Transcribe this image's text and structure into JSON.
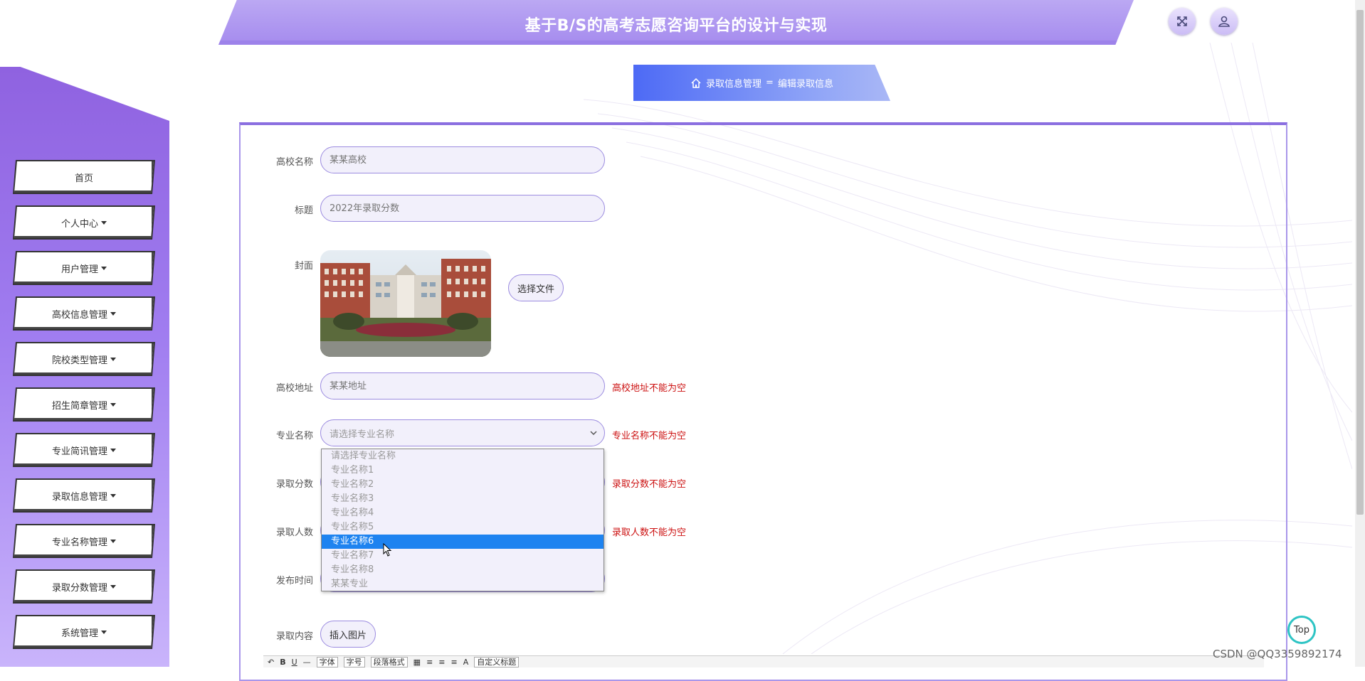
{
  "header": {
    "title": "基于B/S的高考志愿咨询平台的设计与实现",
    "fullscreen_icon": "fullscreen-icon",
    "user_icon": "user-icon"
  },
  "sidebar": {
    "items": [
      {
        "label": "首页",
        "has_caret": false
      },
      {
        "label": "个人中心",
        "has_caret": true
      },
      {
        "label": "用户管理",
        "has_caret": true
      },
      {
        "label": "高校信息管理",
        "has_caret": true
      },
      {
        "label": "院校类型管理",
        "has_caret": true
      },
      {
        "label": "招生简章管理",
        "has_caret": true
      },
      {
        "label": "专业简讯管理",
        "has_caret": true
      },
      {
        "label": "录取信息管理",
        "has_caret": true
      },
      {
        "label": "专业名称管理",
        "has_caret": true
      },
      {
        "label": "录取分数管理",
        "has_caret": true
      },
      {
        "label": "系统管理",
        "has_caret": true
      }
    ]
  },
  "breadcrumb": {
    "home_icon": "home-icon",
    "section": "录取信息管理",
    "separator": "=",
    "page": "编辑录取信息"
  },
  "form": {
    "school_name": {
      "label": "高校名称",
      "placeholder": "某某高校"
    },
    "title": {
      "label": "标题",
      "placeholder": "2022年录取分数"
    },
    "cover": {
      "label": "封面",
      "choose_file": "选择文件"
    },
    "address": {
      "label": "高校地址",
      "placeholder": "某某地址",
      "error": "高校地址不能为空"
    },
    "major": {
      "label": "专业名称",
      "placeholder": "请选择专业名称",
      "error": "专业名称不能为空",
      "options": [
        "请选择专业名称",
        "专业名称1",
        "专业名称2",
        "专业名称3",
        "专业名称4",
        "专业名称5",
        "专业名称6",
        "专业名称7",
        "专业名称8",
        "某某专业"
      ],
      "highlighted": "专业名称6"
    },
    "score": {
      "label": "录取分数",
      "error": "录取分数不能为空"
    },
    "count": {
      "label": "录取人数",
      "error": "录取人数不能为空"
    },
    "publish_time": {
      "label": "发布时间"
    },
    "content": {
      "label": "录取内容",
      "insert_image": "插入图片"
    }
  },
  "editor_toolbar": {
    "font_family": "字体",
    "font_size": "字号",
    "paragraph": "段落格式",
    "custom_title": "自定义标题",
    "bold": "B",
    "underline": "U",
    "font_color": "A"
  },
  "back_to_top": "Top",
  "watermark": "CSDN @QQ3359892174",
  "colors": {
    "accent": "#9d82ea",
    "breadcrumb": "#4d6af5",
    "error": "#cc1111",
    "selected_option": "#1e83f0",
    "top_ring": "#2ec4c4"
  }
}
